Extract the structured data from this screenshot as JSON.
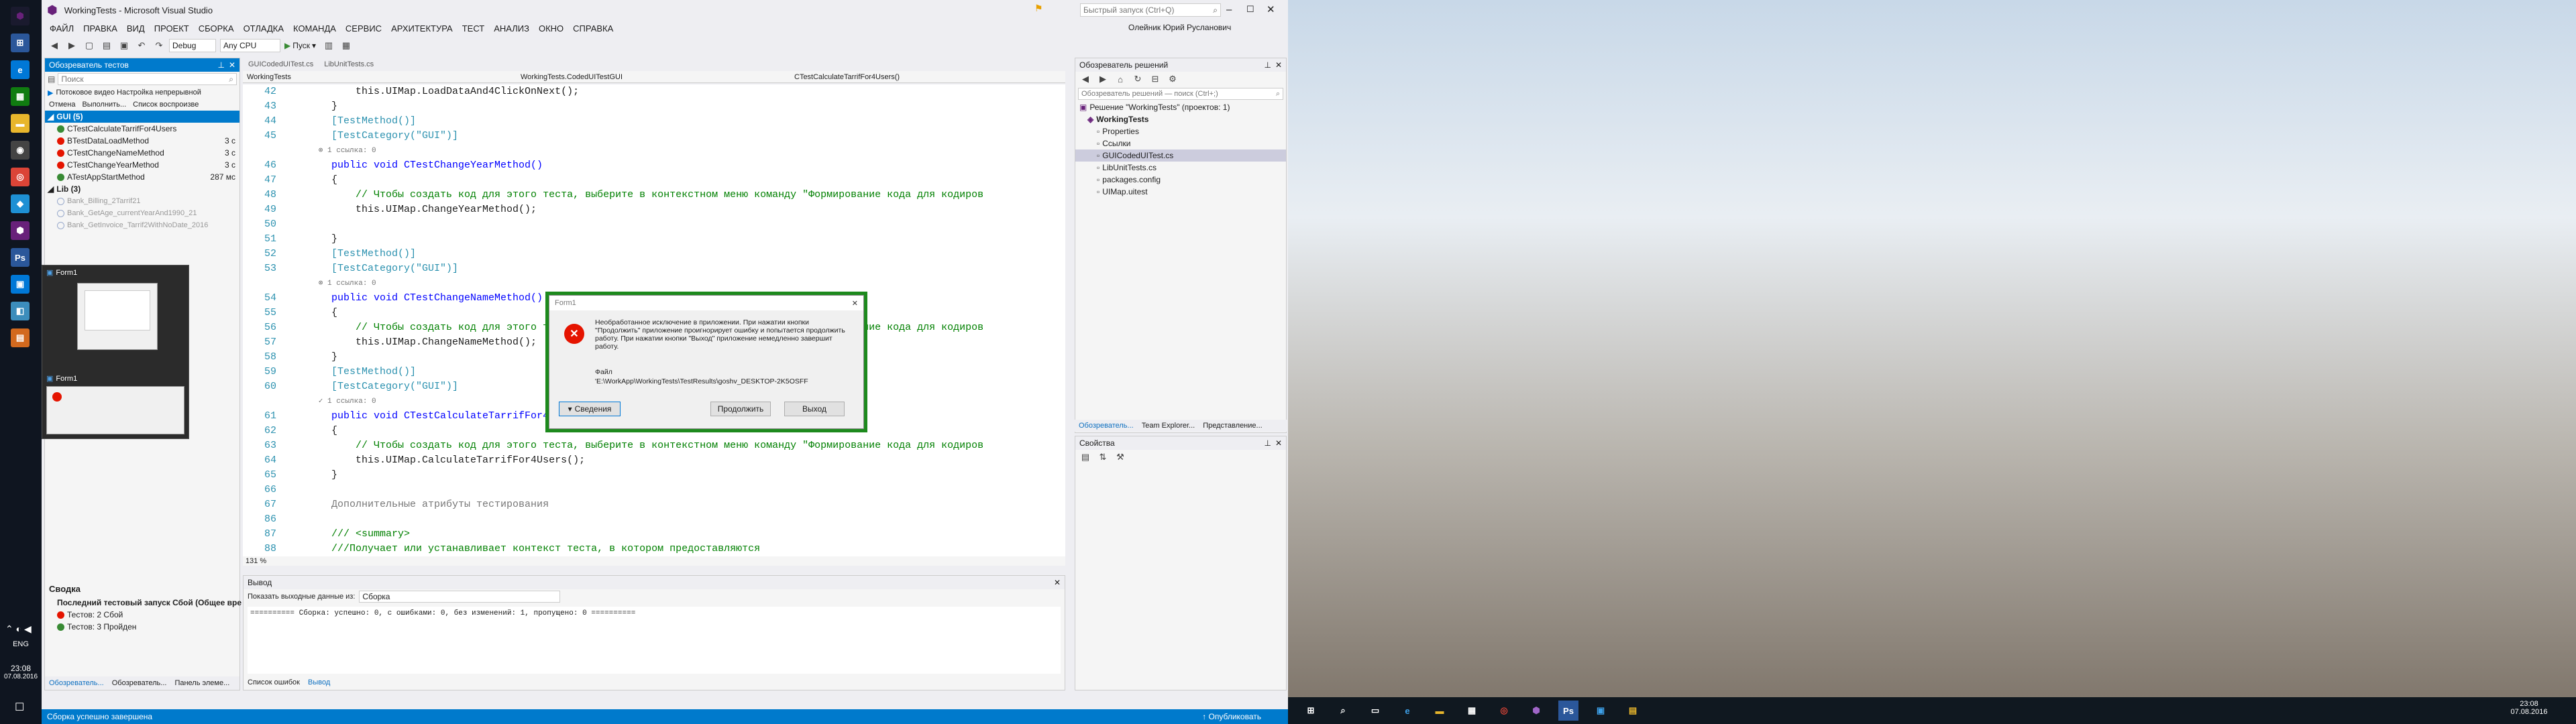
{
  "window": {
    "title": "WorkingTests - Microsoft Visual Studio",
    "quick_launch_placeholder": "Быстрый запуск (Ctrl+Q)",
    "user": "Олейник Юрий Русланович"
  },
  "menu": [
    "ФАЙЛ",
    "ПРАВКА",
    "ВИД",
    "ПРОЕКТ",
    "СБОРКА",
    "ОТЛАДКА",
    "КОМАНДА",
    "СЕРВИС",
    "АРХИТЕКТУРА",
    "ТЕСТ",
    "АНАЛИЗ",
    "ОКНО",
    "СПРАВКА"
  ],
  "toolbar": {
    "config": "Debug",
    "platform": "Any CPU",
    "start": "Пуск"
  },
  "test_explorer": {
    "title": "Обозреватель тестов",
    "search_placeholder": "Поиск",
    "continuous": "Потоковое видео  Настройка непрерывной",
    "run_links": [
      "Отмена",
      "Выполнить...",
      "Список воспроизве"
    ],
    "group_gui": "GUI (5)",
    "gui_tests": [
      {
        "name": "CTestCalculateTarrifFor4Users",
        "status": "pass",
        "time": ""
      },
      {
        "name": "BTestDataLoadMethod",
        "status": "fail",
        "time": "3 с"
      },
      {
        "name": "CTestChangeNameMethod",
        "status": "fail",
        "time": "3 с"
      },
      {
        "name": "CTestChangeYearMethod",
        "status": "fail",
        "time": "3 с"
      },
      {
        "name": "ATestAppStartMethod",
        "status": "pass",
        "time": "287 мс"
      }
    ],
    "group_lib": "Lib (3)",
    "lib_tests": [
      "Bank_Billing_2Tarrif21",
      "Bank_GetAge_currentYearAnd1990_21",
      "Bank_GetInvoice_Tarrif2WithNoDate_2016"
    ],
    "summary_title": "Сводка",
    "summary_last": "Последний тестовый запуск Сбой (Общее вре",
    "summary_failed": "Тестов: 2 Сбой",
    "summary_passed": "Тестов: 3 Пройден",
    "bottom_tabs": [
      "Обозреватель...",
      "Обозреватель...",
      "Панель элеме..."
    ]
  },
  "thumbnails": [
    {
      "title": "Form1"
    },
    {
      "title": "Form1"
    }
  ],
  "tabs": [
    {
      "label": "GUICodedUITest.cs",
      "active": false
    },
    {
      "label": "LibUnitTests.cs",
      "active": false
    }
  ],
  "nav": {
    "project": "WorkingTests",
    "class": "WorkingTests.CodedUITestGUI",
    "member": "CTestCalculateTarrifFor4Users()"
  },
  "code": [
    {
      "n": "42",
      "html": "            this.UIMap.LoadDataAnd4ClickOnNext();"
    },
    {
      "n": "43",
      "html": "        }"
    },
    {
      "n": "44",
      "html": "        [TestMethod()]"
    },
    {
      "n": "45",
      "html": "        [TestCategory(\"GUI\")]"
    },
    {
      "n": "",
      "html": "        ⊗ 1 ссылка: 0"
    },
    {
      "n": "46",
      "html": "        public void CTestChangeYearMethod()"
    },
    {
      "n": "47",
      "html": "        {"
    },
    {
      "n": "48",
      "html": "            // Чтобы создать код для этого теста, выберите в контекстном меню команду \"Формирование кода для кодиров"
    },
    {
      "n": "49",
      "html": "            this.UIMap.ChangeYearMethod();"
    },
    {
      "n": "50",
      "html": ""
    },
    {
      "n": "51",
      "html": "        }"
    },
    {
      "n": "52",
      "html": "        [TestMethod()]"
    },
    {
      "n": "53",
      "html": "        [TestCategory(\"GUI\")]"
    },
    {
      "n": "",
      "html": "        ⊗ 1 ссылка: 0"
    },
    {
      "n": "54",
      "html": "        public void CTestChangeNameMethod()"
    },
    {
      "n": "55",
      "html": "        {"
    },
    {
      "n": "56",
      "html": "            // Чтобы создать код для этого теста, выберите в контекстном меню команду \"Формирование кода для кодиров"
    },
    {
      "n": "57",
      "html": "            this.UIMap.ChangeNameMethod();"
    },
    {
      "n": "58",
      "html": "        }"
    },
    {
      "n": "59",
      "html": "        [TestMethod()]"
    },
    {
      "n": "60",
      "html": "        [TestCategory(\"GUI\")]"
    },
    {
      "n": "",
      "html": "        ✓ 1 ссылка: 0"
    },
    {
      "n": "61",
      "html": "        public void CTestCalculateTarrifFor4Users()"
    },
    {
      "n": "62",
      "html": "        {"
    },
    {
      "n": "63",
      "html": "            // Чтобы создать код для этого теста, выберите в контекстном меню команду \"Формирование кода для кодиров"
    },
    {
      "n": "64",
      "html": "            this.UIMap.CalculateTarrifFor4Users();"
    },
    {
      "n": "65",
      "html": "        }"
    },
    {
      "n": "66",
      "html": ""
    },
    {
      "n": "67",
      "html": "        Дополнительные атрибуты тестирования"
    },
    {
      "n": "86",
      "html": ""
    },
    {
      "n": "87",
      "html": "        /// <summary>"
    },
    {
      "n": "88",
      "html": "        ///Получает или устанавливает контекст теста, в котором предоставляются"
    }
  ],
  "zoom": "131 %",
  "output": {
    "title": "Вывод",
    "show_label": "Показать выходные данные из:",
    "source": "Сборка",
    "text": "========== Сборка: успешно: 0, с ошибками: 0, без изменений: 1, пропущено: 0 ==========",
    "tabs": [
      "Список ошибок",
      "Вывод"
    ]
  },
  "dialog": {
    "title": "Form1",
    "message": "Необработанное исключение в приложении. При нажатии кнопки \"Продолжить\" приложение проигнорирует ошибку и попытается продолжить работу. При нажатии кнопки \"Выход\" приложение немедленно завершит работу.",
    "file_label": "Файл",
    "file_path": "'E:\\WorkApp\\WorkingTests\\TestResults\\goshv_DESKTOP-2K5OSFF",
    "details": "Сведения",
    "continue": "Продолжить",
    "exit": "Выход"
  },
  "solution": {
    "title": "Обозреватель решений",
    "search_placeholder": "Обозреватель решений — поиск (Ctrl+;)",
    "root": "Решение \"WorkingTests\" (проектов: 1)",
    "project": "WorkingTests",
    "items": [
      "Properties",
      "Ссылки",
      "GUICodedUITest.cs",
      "LibUnitTests.cs",
      "packages.config",
      "UIMap.uitest"
    ],
    "bottom_tabs": [
      "Обозреватель...",
      "Team Explorer...",
      "Представление..."
    ]
  },
  "properties": {
    "title": "Свойства"
  },
  "status": {
    "left": "Сборка успешно завершена",
    "right": "↑ Опубликовать"
  },
  "clock": {
    "left_time": "23:08",
    "left_date": "07.08.2016",
    "lang": "ENG",
    "right_time": "23:08",
    "right_date": "07.08.2016"
  }
}
